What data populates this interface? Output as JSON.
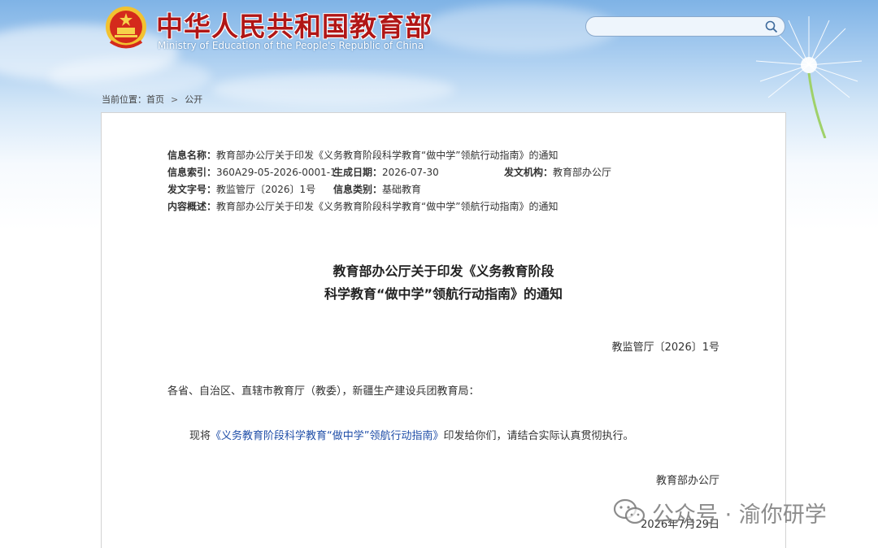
{
  "header": {
    "title": "中华人民共和国教育部",
    "subtitle": "Ministry of Education of the People's Republic of China",
    "search": {
      "placeholder": ""
    }
  },
  "breadcrumb": {
    "prefix": "当前位置：",
    "home": "首页",
    "current": "公开"
  },
  "info": {
    "name_label": "信息名称：",
    "name_value": "教育部办公厅关于印发《义务教育阶段科学教育“做中学”领航行动指南》的通知",
    "index_label": "信息索引：",
    "index_value": "360A29-05-2026-0001-1",
    "date_label": "生成日期：",
    "date_value": "2026-07-30",
    "issuer_label": "发文机构：",
    "issuer_value": "教育部办公厅",
    "docno_label": "发文字号：",
    "docno_value": "教监管厅〔2026〕1号",
    "category_label": "信息类别：",
    "category_value": "基础教育",
    "summary_label": "内容概述：",
    "summary_value": "教育部办公厅关于印发《义务教育阶段科学教育“做中学”领航行动指南》的通知"
  },
  "document": {
    "title_line1": "教育部办公厅关于印发《义务教育阶段",
    "title_line2": "科学教育“做中学”领航行动指南》的通知",
    "number": "教监管厅〔2026〕1号",
    "recipients": "各省、自治区、直辖市教育厅（教委），新疆生产建设兵团教育局：",
    "body_prefix": "现将",
    "body_link": "《义务教育阶段科学教育“做中学”领航行动指南》",
    "body_suffix": "印发给你们，请结合实际认真贯彻执行。",
    "signature": "教育部办公厅",
    "sign_date": "2026年7月29日"
  },
  "watermark": {
    "text": "公众号 · 渝你研学",
    "icon": "wechat-icon"
  },
  "colors": {
    "title_red": "#b01616",
    "link_blue": "#1f4ea8"
  }
}
